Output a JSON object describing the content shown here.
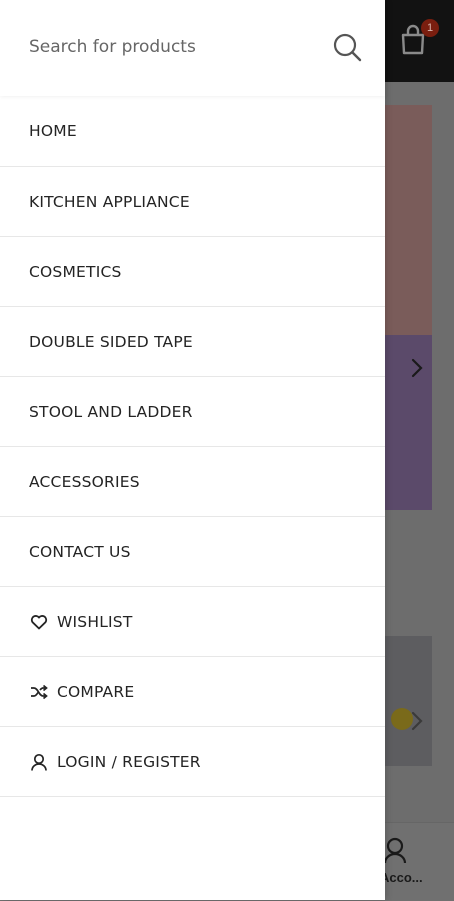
{
  "background": {
    "cart_count": "1",
    "account_label": "Acco..."
  },
  "search": {
    "placeholder": "Search for products"
  },
  "menu": {
    "items": [
      {
        "label": "HOME"
      },
      {
        "label": "KITCHEN APPLIANCE"
      },
      {
        "label": "COSMETICS"
      },
      {
        "label": "DOUBLE SIDED TAPE"
      },
      {
        "label": "STOOL AND LADDER"
      },
      {
        "label": "ACCESSORIES"
      },
      {
        "label": "CONTACT US"
      },
      {
        "label": "WISHLIST",
        "icon": "heart-icon"
      },
      {
        "label": "COMPARE",
        "icon": "shuffle-icon"
      },
      {
        "label": "LOGIN / REGISTER",
        "icon": "user-icon"
      }
    ]
  },
  "colors": {
    "drawer_bg": "#ffffff",
    "text": "#242424",
    "overlay": "#6d6d6d",
    "header_bg": "#121212",
    "badge": "#7a1e0f"
  }
}
